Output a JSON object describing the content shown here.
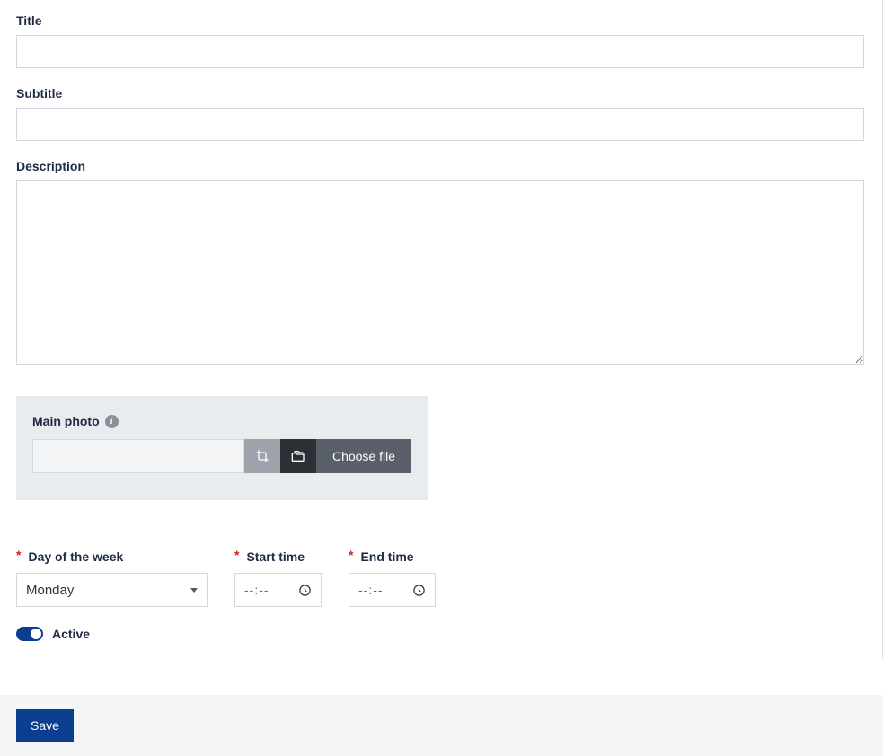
{
  "form": {
    "title_label": "Title",
    "title_value": "",
    "subtitle_label": "Subtitle",
    "subtitle_value": "",
    "description_label": "Description",
    "description_value": ""
  },
  "photo": {
    "label": "Main photo",
    "info_icon": "i",
    "path_value": "",
    "choose_label": "Choose file"
  },
  "schedule": {
    "day_label": "Day of the week",
    "day_value": "Monday",
    "start_label": "Start time",
    "start_placeholder": "--:--",
    "end_label": "End time",
    "end_placeholder": "--:--"
  },
  "active": {
    "label": "Active",
    "value": true
  },
  "footer": {
    "save_label": "Save"
  },
  "required_marker": "*"
}
